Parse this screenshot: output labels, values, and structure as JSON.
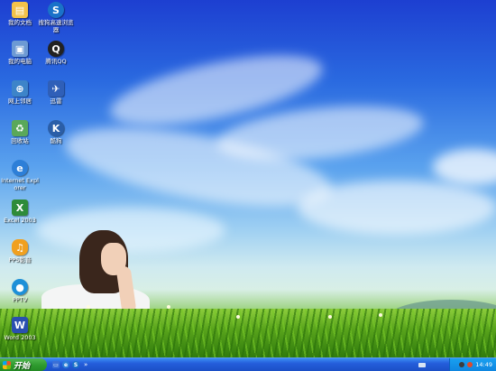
{
  "desktop_icons": [
    {
      "name": "my-documents",
      "label": "我的文档",
      "icon": "folder-docs-icon",
      "color": "#f3c24a",
      "glyph": "📁"
    },
    {
      "name": "browser",
      "label": "搜狗高速浏览器",
      "icon": "sogou-browser-icon",
      "color": "#1a72c9",
      "glyph": "S"
    },
    {
      "name": "my-computer",
      "label": "我的电脑",
      "icon": "computer-icon",
      "color": "#6d9ad4",
      "glyph": "▣"
    },
    {
      "name": "qq",
      "label": "腾讯QQ",
      "icon": "penguin-icon",
      "color": "#d13b2a",
      "glyph": "Q"
    },
    {
      "name": "network",
      "label": "网上邻居",
      "icon": "network-icon",
      "color": "#3d84c9",
      "glyph": "⊕"
    },
    {
      "name": "thunder",
      "label": "迅雷",
      "icon": "bird-icon",
      "color": "#2f5fb8",
      "glyph": "✈"
    },
    {
      "name": "recycle-bin",
      "label": "回收站",
      "icon": "recycle-bin-icon",
      "color": "#5aa85a",
      "glyph": "♻"
    },
    {
      "name": "kugou",
      "label": "酷狗",
      "icon": "k-music-icon",
      "color": "#2a5ea8",
      "glyph": "K"
    },
    {
      "name": "ie",
      "label": "Internet Explorer",
      "icon": "internet-explorer-icon",
      "color": "#2d7fd8",
      "glyph": "e"
    },
    {
      "name": "excel",
      "label": "Excel 2003",
      "icon": "excel-icon",
      "color": "#2e8b3a",
      "glyph": "X"
    },
    {
      "name": "pps",
      "label": "PPS影音",
      "icon": "pps-icon",
      "color": "#f0a020",
      "glyph": "♫"
    },
    {
      "name": "pptv",
      "label": "PPTV",
      "icon": "globe-icon",
      "color": "#1e90d8",
      "glyph": "●"
    },
    {
      "name": "word",
      "label": "Word 2003",
      "icon": "word-icon",
      "color": "#2a4fb0",
      "glyph": "W"
    }
  ],
  "taskbar": {
    "start_label": "开始",
    "quick_launch": [
      {
        "icon": "desktop-show-icon",
        "glyph": "▭",
        "color": "#3a6fd6"
      },
      {
        "icon": "internet-explorer-icon",
        "glyph": "e",
        "color": "#2d7fd8"
      },
      {
        "icon": "sogou-browser-icon",
        "glyph": "S",
        "color": "#1a72c9"
      }
    ],
    "chevron": "»",
    "clock": "14:49"
  }
}
